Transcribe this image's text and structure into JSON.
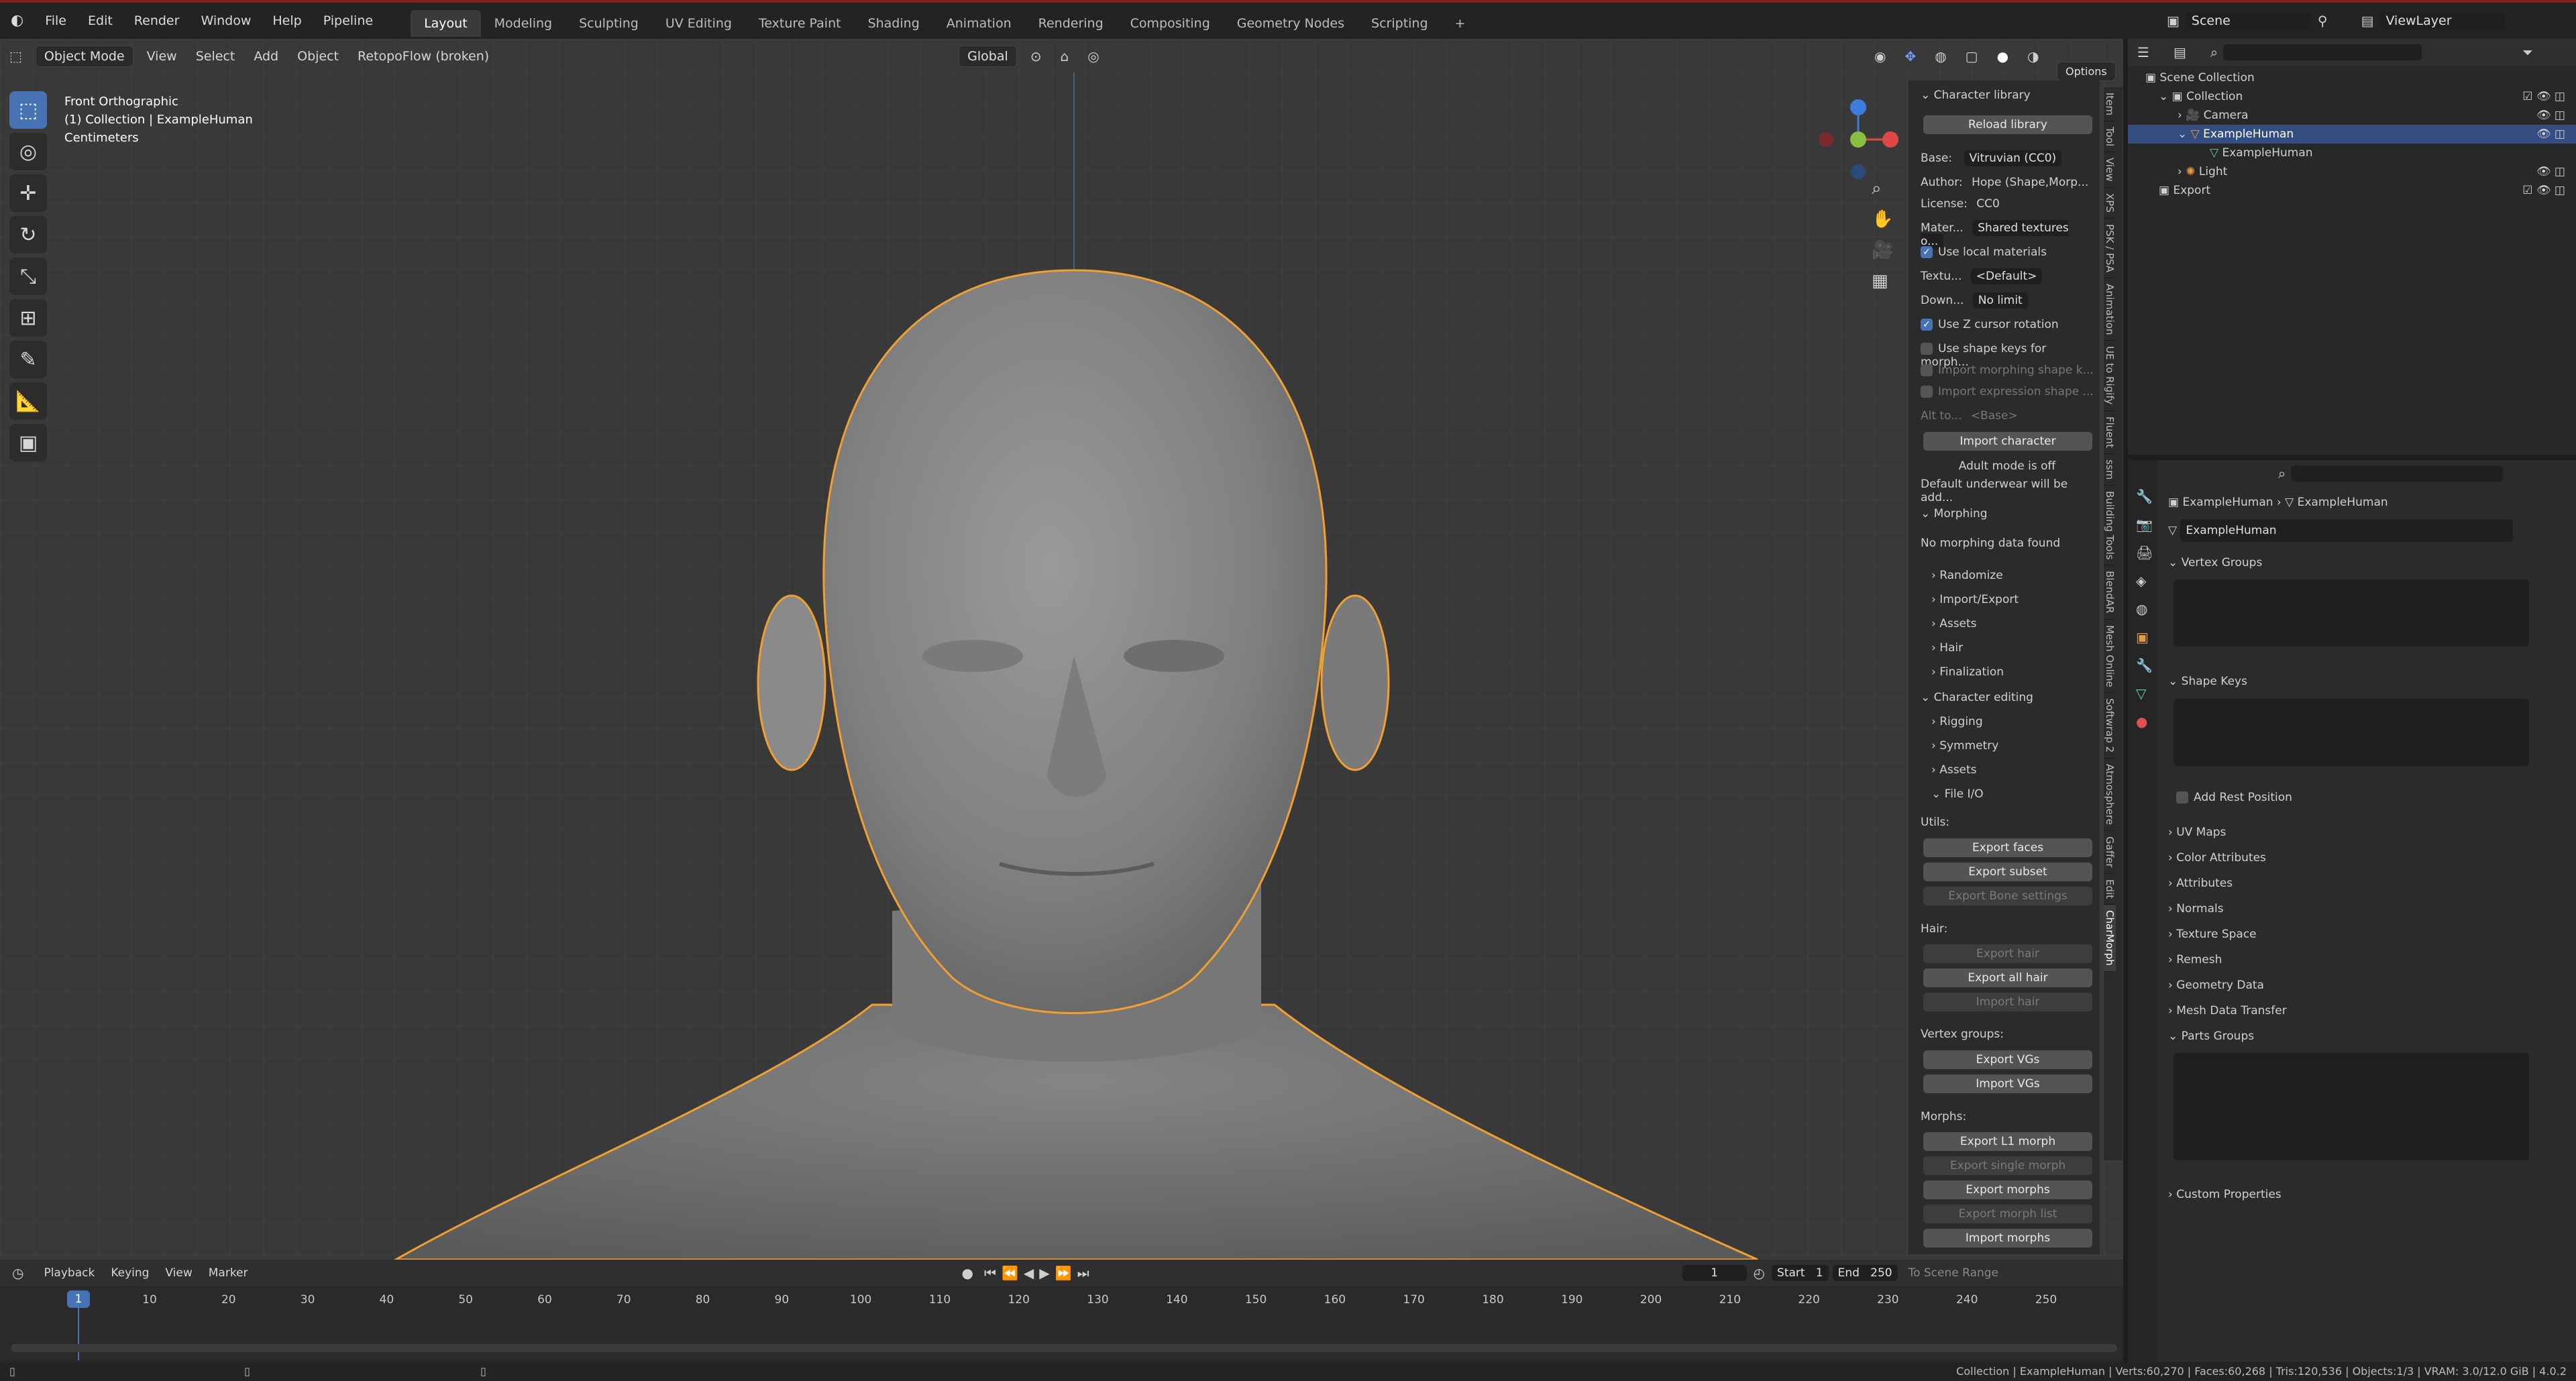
{
  "topbar": {
    "menus": [
      "File",
      "Edit",
      "Render",
      "Window",
      "Help",
      "Pipeline"
    ],
    "workspaces": [
      "Layout",
      "Modeling",
      "Sculpting",
      "UV Editing",
      "Texture Paint",
      "Shading",
      "Animation",
      "Rendering",
      "Compositing",
      "Geometry Nodes",
      "Scripting"
    ],
    "active_workspace": "Layout",
    "add_tab": "+",
    "scene": "Scene",
    "view_layer": "ViewLayer"
  },
  "viewport_header": {
    "mode": "Object Mode",
    "menus": [
      "View",
      "Select",
      "Add",
      "Object"
    ],
    "addon_menu": "RetopoFlow (broken)",
    "orientation": "Global",
    "options": "Options"
  },
  "viewport_overlay": {
    "view_name": "Front Orthographic",
    "collection": "(1) Collection | ExampleHuman",
    "units": "Centimeters"
  },
  "npanel": {
    "header": "Character library",
    "reload": "Reload library",
    "base_label": "Base:",
    "base_value": "Vitruvian (CC0)",
    "author_label": "Author:",
    "author_value": "Hope (Shape,Morp...",
    "license_label": "License:",
    "license_value": "CC0",
    "material_label": "Mater...",
    "material_value": "Shared textures o...",
    "use_local_materials": "Use local materials",
    "texture_label": "Textu...",
    "texture_value": "<Default>",
    "download_label": "Down...",
    "download_value": "No limit",
    "use_z_cursor": "Use Z cursor rotation",
    "use_shape_keys": "Use shape keys for morph...",
    "import_morphing": "Import morphing shape k...",
    "import_expression": "Import expression shape ...",
    "alt_label": "Alt to...",
    "alt_value": "<Base>",
    "import_character": "Import character",
    "adult_mode": "Adult mode is off",
    "underwear": "Default underwear will be add...",
    "morphing_header": "Morphing",
    "no_morphing": "No morphing data found",
    "subpanels_a": [
      "Randomize",
      "Import/Export",
      "Assets",
      "Hair",
      "Finalization"
    ],
    "char_editing": "Character editing",
    "subpanels_b": [
      "Rigging",
      "Symmetry",
      "Assets",
      "File I/O"
    ],
    "utils_label": "Utils:",
    "export_faces": "Export faces",
    "export_subset": "Export subset",
    "export_bone": "Export Bone settings",
    "hair_label": "Hair:",
    "export_hair": "Export hair",
    "export_all_hair": "Export all hair",
    "import_hair": "Import hair",
    "vg_label": "Vertex groups:",
    "export_vgs": "Export VGs",
    "import_vgs": "Import VGs",
    "morphs_label": "Morphs:",
    "export_l1": "Export L1 morph",
    "export_single": "Export single morph",
    "export_morphs": "Export morphs",
    "export_morph_list": "Export morph list",
    "import_morphs": "Import morphs"
  },
  "side_tabs": [
    "Item",
    "Tool",
    "View",
    "XPS",
    "PSK / PSA",
    "Animation",
    "UE to Rigify",
    "Fluent",
    "ssm",
    "Building Tools",
    "BlendAR",
    "Mesh Online",
    "Softwrap 2",
    "Atmosphere",
    "Gaffer",
    "Edit",
    "CharMorph"
  ],
  "active_side_tab": "CharMorph",
  "outliner": {
    "scene_collection": "Scene Collection",
    "items": [
      {
        "label": "Collection",
        "indent": 1
      },
      {
        "label": "Camera",
        "indent": 2
      },
      {
        "label": "ExampleHuman",
        "indent": 2
      },
      {
        "label": "ExampleHuman",
        "indent": 3
      },
      {
        "label": "Light",
        "indent": 2
      },
      {
        "label": "Export",
        "indent": 1
      }
    ]
  },
  "properties": {
    "breadcrumb_object": "ExampleHuman",
    "breadcrumb_mesh": "ExampleHuman",
    "data_name": "ExampleHuman",
    "vertex_groups": "Vertex Groups",
    "shape_keys": "Shape Keys",
    "add_rest_position": "Add Rest Position",
    "panels": [
      "UV Maps",
      "Color Attributes",
      "Attributes",
      "Normals",
      "Texture Space",
      "Remesh",
      "Geometry Data",
      "Mesh Data Transfer"
    ],
    "parts_groups": "Parts Groups",
    "custom_properties": "Custom Properties"
  },
  "timeline": {
    "menus": [
      "Playback",
      "Keying",
      "View",
      "Marker"
    ],
    "current_frame": "1",
    "start_label": "Start",
    "start_value": "1",
    "end_label": "End",
    "end_value": "250",
    "to_scene_range": "To Scene Range",
    "ticks": [
      "10",
      "20",
      "30",
      "40",
      "50",
      "60",
      "70",
      "80",
      "90",
      "100",
      "110",
      "120",
      "130",
      "140",
      "150",
      "160",
      "170",
      "180",
      "190",
      "200",
      "210",
      "220",
      "230",
      "240",
      "250"
    ],
    "playhead": "1"
  },
  "statusbar": {
    "text": "Collection | ExampleHuman | Verts:60,270 | Faces:60,268 | Tris:120,536 | Objects:1/3 | VRAM: 3.0/12.0 GiB | 4.0.2"
  },
  "colors": {
    "accent": "#4772b3",
    "selection_outline": "#f0a030",
    "viewport_bg": "#393939"
  }
}
